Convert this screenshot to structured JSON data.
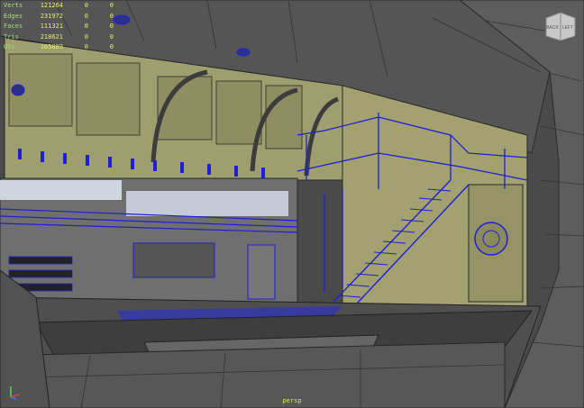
{
  "hud": {
    "rows": [
      {
        "label": "Verts",
        "v1": "121264",
        "v2": "0",
        "v3": "0"
      },
      {
        "label": "Edges",
        "v1": "231972",
        "v2": "0",
        "v3": "0"
      },
      {
        "label": "Faces",
        "v1": "111321",
        "v2": "0",
        "v3": "0"
      },
      {
        "label": "Tris",
        "v1": "218621",
        "v2": "0",
        "v3": "0"
      },
      {
        "label": "UVs",
        "v1": "165089",
        "v2": "0",
        "v3": "0"
      }
    ]
  },
  "viewcube": {
    "face_back": "BACK",
    "face_left": "LEFT"
  },
  "camera_label": "persp",
  "colors": {
    "wire": "#1f1fd6",
    "panel": "#9a9a6a",
    "hull": "#5b5b5b",
    "hud_text": "#e8f06a"
  }
}
